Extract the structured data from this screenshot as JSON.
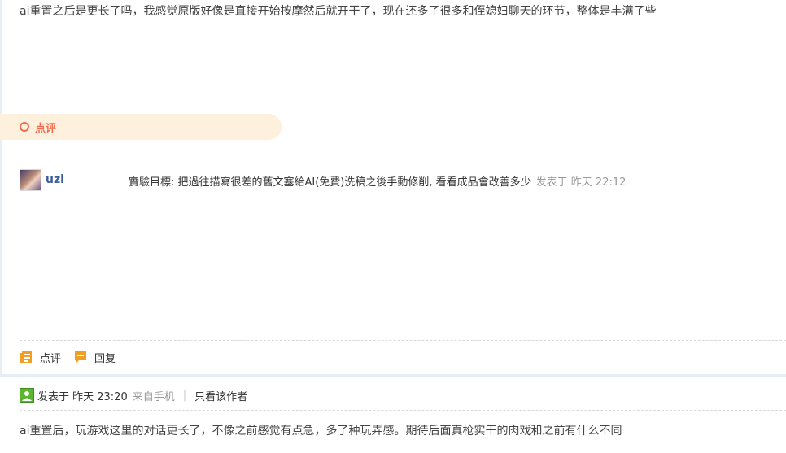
{
  "post1": {
    "content": "ai重置之后是更长了吗，我感觉原版好像是直接开始按摩然后就开干了，现在还多了很多和侄媳妇聊天的环节，整体是丰满了些"
  },
  "rating": {
    "label": "点评"
  },
  "comment": {
    "user": "uzi",
    "text": "實驗目標: 把過往描寫很差的舊文塞給AI(免費)洗稿之後手動修削, 看看成品會改善多少",
    "time": "发表于 昨天 22:12"
  },
  "actions": {
    "rate_label": "点评",
    "reply_label": "回复"
  },
  "post2": {
    "posted_at": "发表于 昨天 23:20",
    "source": "来自手机",
    "separator": "|",
    "only_author": "只看该作者",
    "content": "ai重置后，玩游戏这里的对话更长了，不像之前感觉有点急，多了种玩弄感。期待后面真枪实干的肉戏和之前有什么不同"
  },
  "icons": {
    "rate_icon": "rate-icon",
    "reply_icon": "reply-icon",
    "online_icon": "online-user-icon",
    "ring_icon": "ring-icon"
  },
  "colors": {
    "accent_orange": "#f26c4f",
    "rate_bar_bg": "#fdf1de",
    "username_blue": "#3a5d9c",
    "icon_orange": "#f0a020",
    "online_green": "#5cb531"
  }
}
